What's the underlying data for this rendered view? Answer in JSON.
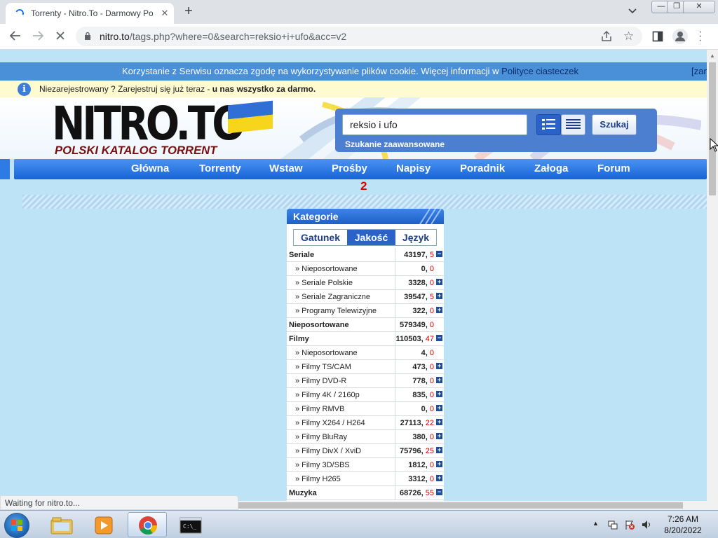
{
  "browser": {
    "tab_title": "Torrenty - Nitro.To - Darmowy Po",
    "url_host": "nitro.to",
    "url_path": "/tags.php?where=0&search=reksio+i+ufo&acc=v2",
    "status_text": "Waiting for nitro.to..."
  },
  "cookie_bar": {
    "text": "Korzystanie z Serwisu oznacza zgodę na wykorzystywanie plików cookie. Więcej informacji w ",
    "link": "Polityce ciasteczek",
    "close": "[zan"
  },
  "register_bar": {
    "text": "Niezarejestrowany ? Zarejestruj się już teraz - ",
    "bold": "u nas wszystko za darmo."
  },
  "logo": {
    "main": "NITRO.TO",
    "sub": "POLSKI KATALOG TORRENT"
  },
  "search": {
    "value": "reksio i ufo",
    "button": "Szukaj",
    "advanced": "Szukanie zaawansowane"
  },
  "nav": {
    "items": [
      "Główna",
      "Torrenty",
      "Wstaw",
      "Prośby",
      "Napisy",
      "Poradnik",
      "Załoga",
      "Forum"
    ],
    "requests_badge": "2"
  },
  "categories": {
    "title": "Kategorie",
    "tabs": [
      "Gatunek",
      "Jakość",
      "Język"
    ],
    "active_tab": "Jakość",
    "rows": [
      {
        "name": "Seriale",
        "level": "top",
        "count": "43197,",
        "new": " 5",
        "toggle": "−"
      },
      {
        "name": "» Nieposortowane",
        "level": "sub",
        "count": "0,",
        "new": " 0",
        "toggle": ""
      },
      {
        "name": "» Seriale Polskie",
        "level": "sub",
        "count": "3328,",
        "new": " 0",
        "toggle": "+"
      },
      {
        "name": "» Seriale Zagraniczne",
        "level": "sub",
        "count": "39547,",
        "new": " 5",
        "toggle": "+"
      },
      {
        "name": "» Programy Telewizyjne",
        "level": "sub",
        "count": "322,",
        "new": " 0",
        "toggle": "+"
      },
      {
        "name": "Nieposortowane",
        "level": "top",
        "count": "579349,",
        "new": " 0",
        "toggle": ""
      },
      {
        "name": "Filmy",
        "level": "top",
        "count": "110503,",
        "new": " 47",
        "toggle": "−"
      },
      {
        "name": "» Nieposortowane",
        "level": "sub",
        "count": "4,",
        "new": " 0",
        "toggle": ""
      },
      {
        "name": "» Filmy TS/CAM",
        "level": "sub",
        "count": "473,",
        "new": " 0",
        "toggle": "+"
      },
      {
        "name": "» Filmy DVD-R",
        "level": "sub",
        "count": "778,",
        "new": " 0",
        "toggle": "+"
      },
      {
        "name": "» Filmy 4K / 2160p",
        "level": "sub",
        "count": "835,",
        "new": " 0",
        "toggle": "+"
      },
      {
        "name": "» Filmy RMVB",
        "level": "sub",
        "count": "0,",
        "new": " 0",
        "toggle": "+"
      },
      {
        "name": "» Filmy X264 / H264",
        "level": "sub",
        "count": "27113,",
        "new": " 22",
        "toggle": "+"
      },
      {
        "name": "» Filmy BluRay",
        "level": "sub",
        "count": "380,",
        "new": " 0",
        "toggle": "+"
      },
      {
        "name": "» Filmy DivX / XviD",
        "level": "sub",
        "count": "75796,",
        "new": " 25",
        "toggle": "+"
      },
      {
        "name": "» Filmy 3D/SBS",
        "level": "sub",
        "count": "1812,",
        "new": " 0",
        "toggle": "+"
      },
      {
        "name": "» Filmy H265",
        "level": "sub",
        "count": "3312,",
        "new": " 0",
        "toggle": "+"
      },
      {
        "name": "Muzyka",
        "level": "top",
        "count": "68726,",
        "new": " 55",
        "toggle": "−"
      }
    ]
  },
  "taskbar": {
    "time": "7:26 AM",
    "date": "8/20/2022",
    "apps": [
      "explorer-icon",
      "media-player-icon",
      "chrome-icon",
      "cmd-icon"
    ]
  },
  "colors": {
    "page_bg": "#bde3f7",
    "nav_blue": "#1663d6",
    "cookie_bar": "#4a90d9",
    "badge_red": "#e00000"
  }
}
